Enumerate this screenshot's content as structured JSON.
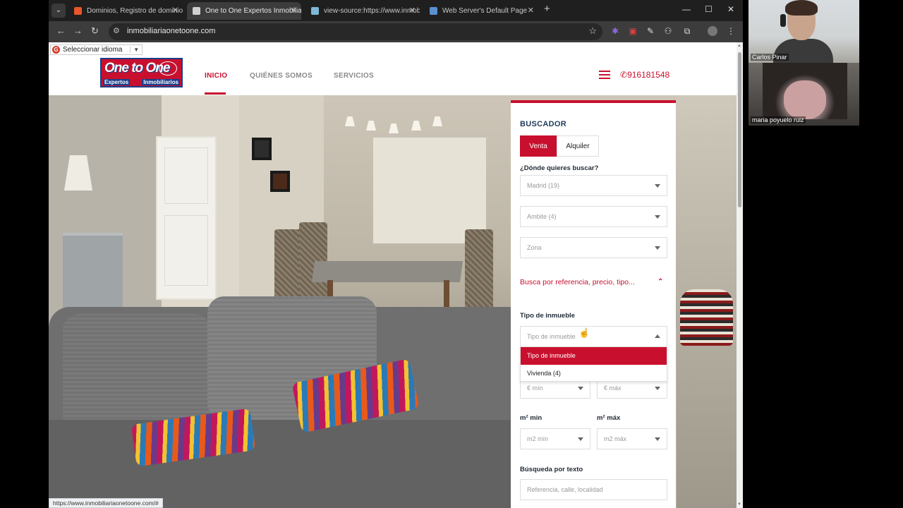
{
  "browser": {
    "tabs": [
      {
        "title": "Dominios, Registro de dominio",
        "active": false,
        "favicon_color": "#e8562a"
      },
      {
        "title": "One to One Expertos Inmobiliarios",
        "active": true,
        "favicon_color": "#d0d0d0"
      },
      {
        "title": "view-source:https://www.inmobi",
        "active": false,
        "favicon_color": "#7fb8d8"
      },
      {
        "title": "Web Server's Default Page",
        "active": false,
        "favicon_color": "#5a8fd0"
      }
    ],
    "url": "inmobiliariaonetoone.com",
    "status_url": "https://www.inmobiliariaonetoone.com/#"
  },
  "translate": {
    "label": "Seleccionar idioma",
    "arrow": "▼"
  },
  "site": {
    "logo": {
      "line1": "One to One",
      "left_tag": "Expertos",
      "right_tag": "Inmobiliarios"
    },
    "nav": [
      {
        "label": "INICIO",
        "active": true
      },
      {
        "label": "QUIÉNES SOMOS",
        "active": false
      },
      {
        "label": "SERVICIOS",
        "active": false
      }
    ],
    "phone": "916181548"
  },
  "search": {
    "title": "BUSCADOR",
    "operation_buy": "Venta",
    "operation_rent": "Alquiler",
    "where_label": "¿Dónde quieres buscar?",
    "province": "Madrid (19)",
    "area": "Ambite (4)",
    "zone": "Zona",
    "ref_link": "Busca por referencia, precio, tipo...",
    "type_label": "Tipo de inmueble",
    "type_placeholder": "Tipo de inmueble",
    "type_options": [
      "Tipo de inmueble",
      "Vivienda (4)"
    ],
    "price_min": "€ mín",
    "price_max": "€ máx",
    "m2_min_label": "m² min",
    "m2_max_label": "m² máx",
    "m2_min": "m2 mín",
    "m2_max": "m2 máx",
    "text_label": "Búsqueda por texto",
    "text_placeholder": "Referencia, calle, localidad"
  },
  "call": {
    "participants": [
      "Carlos Pinar",
      "maria poyuelo ruiz"
    ]
  },
  "colors": {
    "brand_red": "#c8102e",
    "brand_blue": "#1c3d8a",
    "browser_dark": "#1f1f1f"
  }
}
